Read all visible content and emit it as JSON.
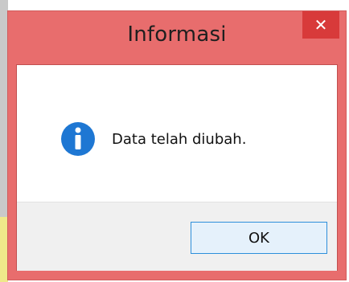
{
  "dialog": {
    "title": "Informasi",
    "close_label": "✕",
    "message": "Data telah diubah.",
    "ok_label": "OK"
  },
  "icons": {
    "close": "close-icon",
    "info": "info-icon"
  },
  "colors": {
    "frame": "#e86d6d",
    "close_button": "#d83a3a",
    "ok_border": "#2d8fdb",
    "info_icon": "#1e77d3"
  }
}
